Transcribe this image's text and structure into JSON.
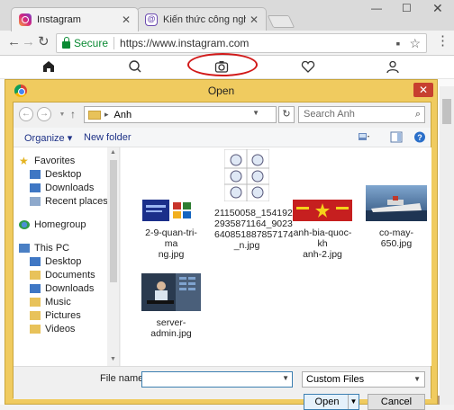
{
  "browser": {
    "tabs": [
      {
        "title": "Instagram",
        "close": "✕"
      },
      {
        "title": "Kiến thức công nghệ khó",
        "close": "✕"
      }
    ],
    "window_controls": {
      "minimize": "—",
      "maximize": "☐",
      "close": "✕"
    },
    "omnibox": {
      "secure_label": "Secure",
      "url": "https://www.instagram.com"
    }
  },
  "dialog": {
    "title": "Open",
    "close": "✕",
    "breadcrumb": "Anh",
    "search_placeholder": "Search Anh",
    "organize_label": "Organize ▾",
    "new_folder_label": "New folder",
    "nav": {
      "favorites": "Favorites",
      "desktop": "Desktop",
      "downloads": "Downloads",
      "recent": "Recent places",
      "homegroup": "Homegroup",
      "this_pc": "This PC",
      "pc_desktop": "Desktop",
      "documents": "Documents",
      "pc_downloads": "Downloads",
      "music": "Music",
      "pictures": "Pictures",
      "videos": "Videos"
    },
    "files": [
      {
        "name_lines": [
          "2-9-quan-tri-ma",
          "ng.jpg"
        ]
      },
      {
        "name_lines": [
          "21150058_154192",
          "2935871164_9023",
          "640851887857174",
          "_n.jpg"
        ]
      },
      {
        "name_lines": [
          "anh-bia-quoc-kh",
          "anh-2.jpg"
        ]
      },
      {
        "name_lines": [
          "co-may-650.jpg"
        ]
      },
      {
        "name_lines": [
          "server-admin.jpg"
        ]
      }
    ],
    "file_name_label": "File name:",
    "file_name_value": "",
    "filter_value": "Custom Files",
    "open_label": "Open",
    "cancel_label": "Cancel"
  }
}
